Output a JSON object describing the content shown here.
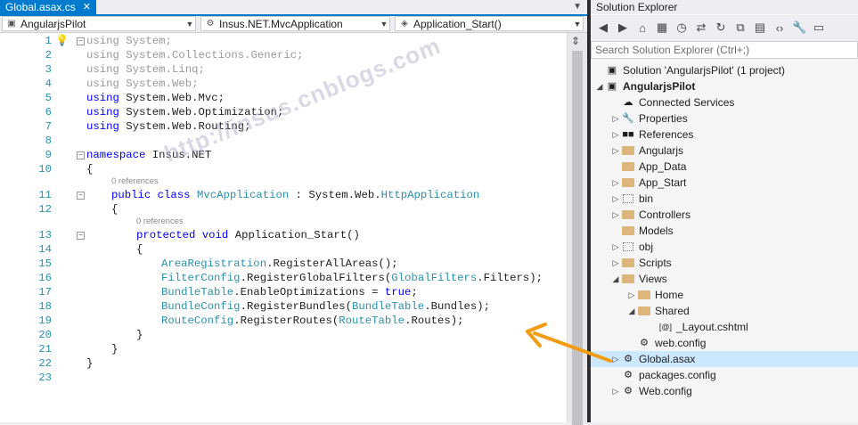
{
  "editor": {
    "tab": {
      "title": "Global.asax.cs",
      "close": "✕"
    },
    "nav": {
      "project": "AngularjsPilot",
      "class": "Insus.NET.MvcApplication",
      "member": "Application_Start()"
    },
    "line_numbers": [
      "1",
      "2",
      "3",
      "4",
      "5",
      "6",
      "7",
      "8",
      "9",
      "10",
      "11",
      "12",
      "13",
      "14",
      "15",
      "16",
      "17",
      "18",
      "19",
      "20",
      "21",
      "22",
      "23"
    ],
    "lines": {
      "l1": [
        "using",
        " System;"
      ],
      "l2": [
        "using",
        " System.Collections.Generic;"
      ],
      "l3": [
        "using",
        " System.Linq;"
      ],
      "l4": [
        "using",
        " System.Web;"
      ],
      "l5": [
        "using",
        " System.Web.Mvc;"
      ],
      "l6": [
        "using",
        " System.Web.Optimization;"
      ],
      "l7": [
        "using",
        " System.Web.Routing;"
      ],
      "l9": [
        "namespace",
        " Insus.NET"
      ],
      "l10": "{",
      "l11": [
        "public class",
        "MvcApplication",
        " : System.Web.",
        "HttpApplication"
      ],
      "l12": "{",
      "l13": [
        "protected void",
        " Application_Start()"
      ],
      "l14": "{",
      "l15": [
        "AreaRegistration",
        ".RegisterAllAreas();"
      ],
      "l16": [
        "FilterConfig",
        ".RegisterGlobalFilters(",
        "GlobalFilters",
        ".Filters);"
      ],
      "l17": [
        "BundleTable",
        ".EnableOptimizations = ",
        "true",
        ";"
      ],
      "l18": [
        "BundleConfig",
        ".RegisterBundles(",
        "BundleTable",
        ".Bundles);"
      ],
      "l19": [
        "RouteConfig",
        ".RegisterRoutes(",
        "RouteTable",
        ".Routes);"
      ],
      "l20": "}",
      "l21": "}",
      "l22": "}"
    },
    "refs": {
      "class": "0 references",
      "method": "0 references"
    },
    "watermark": "http://insus.cnblogs.com"
  },
  "solution_explorer": {
    "title": "Solution Explorer",
    "search_placeholder": "Search Solution Explorer (Ctrl+;)",
    "tree": [
      {
        "label": "Solution 'AngularjsPilot' (1 project)",
        "icon": "solution-icon"
      },
      {
        "label": "AngularjsPilot",
        "icon": "project-icon"
      },
      {
        "label": "Connected Services",
        "icon": "cloud-icon"
      },
      {
        "label": "Properties",
        "icon": "wrench-icon"
      },
      {
        "label": "References",
        "icon": "references-icon"
      },
      {
        "label": "Angularjs",
        "icon": "folder-icon"
      },
      {
        "label": "App_Data",
        "icon": "folder-icon"
      },
      {
        "label": "App_Start",
        "icon": "folder-icon"
      },
      {
        "label": "bin",
        "icon": "folder-dotted-icon"
      },
      {
        "label": "Controllers",
        "icon": "folder-icon"
      },
      {
        "label": "Models",
        "icon": "folder-icon"
      },
      {
        "label": "obj",
        "icon": "folder-dotted-icon"
      },
      {
        "label": "Scripts",
        "icon": "folder-icon"
      },
      {
        "label": "Views",
        "icon": "folder-icon"
      },
      {
        "label": "Home",
        "icon": "folder-icon"
      },
      {
        "label": "Shared",
        "icon": "folder-icon"
      },
      {
        "label": "_Layout.cshtml",
        "icon": "razor-file-icon"
      },
      {
        "label": "web.config",
        "icon": "config-file-icon"
      },
      {
        "label": "Global.asax",
        "icon": "asax-file-icon",
        "selected": true
      },
      {
        "label": "packages.config",
        "icon": "config-file-icon"
      },
      {
        "label": "Web.config",
        "icon": "config-file-icon"
      }
    ]
  },
  "colors": {
    "accent": "#007acc",
    "keyword": "#0000ff",
    "type": "#2b91af",
    "arrow": "#f39c12"
  }
}
